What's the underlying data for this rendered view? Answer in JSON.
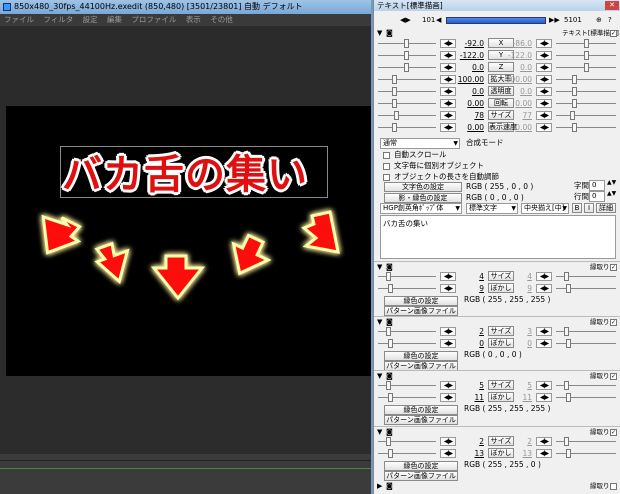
{
  "left_window": {
    "title": "850x480_30fps_44100Hz.exedit (850,480)  [3501/23801]  自動  デフォルト",
    "menu": [
      "ファイル",
      "フィルタ",
      "設定",
      "編集",
      "プロファイル",
      "表示",
      "その他"
    ],
    "caption_text": "バカ舌の集い"
  },
  "right_panel": {
    "title": "テキスト[標準描画]",
    "header": {
      "frame_start": "101",
      "frame_end": "5101",
      "object_label": "テキスト[標準描画]"
    },
    "params": [
      {
        "left": "-92.0",
        "label": "X",
        "right": "-86.0"
      },
      {
        "left": "-122.0",
        "label": "Y",
        "right": "-122.0"
      },
      {
        "left": "0.0",
        "label": "Z",
        "right": "0.0"
      },
      {
        "left": "100.00",
        "label": "拡大率",
        "right": "100.00"
      },
      {
        "left": "0.0",
        "label": "透明度",
        "right": "0.0"
      },
      {
        "left": "0.00",
        "label": "回転",
        "right": "0.00"
      },
      {
        "left": "78",
        "label": "サイズ",
        "right": "77"
      },
      {
        "left": "0.00",
        "label": "表示速度",
        "right": "0.00"
      }
    ],
    "blend_mode": "通常",
    "blend_mode_label": "合成モード",
    "checks": [
      "自動スクロール",
      "文字毎に個別オブジェクト",
      "オブジェクトの長さを自動調節"
    ],
    "text_color_btn": "文字色の設定",
    "text_color_val": "RGB ( 255 , 0 , 0 )",
    "edge_color_btn": "影・縁色の設定",
    "edge_color_val": "RGB ( 0 , 0 , 0 )",
    "spacing_label": "字間",
    "spacing_val": "0",
    "line_label": "行間",
    "line_val": "0",
    "font": "HGP創英角ﾎﾟｯﾌﾟ体",
    "style": "標準文字",
    "align": "中央揃え[中]",
    "bold": "B",
    "italic": "I",
    "detail": "詳細",
    "text_body": "バカ舌の集い",
    "filters": [
      {
        "title": "縁取り",
        "size_l": "4",
        "size_r": "4",
        "blur_l": "9",
        "blur_r": "9",
        "color_btn": "縁色の設定",
        "color_val": "RGB ( 255 , 255 , 255 )",
        "pattern": "パターン画像ファイル",
        "size_label": "サイズ",
        "blur_label": "ぼかし"
      },
      {
        "title": "縁取り",
        "size_l": "2",
        "size_r": "3",
        "blur_l": "0",
        "blur_r": "0",
        "color_btn": "縁色の設定",
        "color_val": "RGB ( 0 , 0 , 0 )",
        "pattern": "パターン画像ファイル",
        "size_label": "サイズ",
        "blur_label": "ぼかし"
      },
      {
        "title": "縁取り",
        "size_l": "5",
        "size_r": "5",
        "blur_l": "11",
        "blur_r": "11",
        "color_btn": "縁色の設定",
        "color_val": "RGB ( 255 , 255 , 255 )",
        "pattern": "パターン画像ファイル",
        "size_label": "サイズ",
        "blur_label": "ぼかし"
      },
      {
        "title": "縁取り",
        "size_l": "2",
        "size_r": "2",
        "blur_l": "13",
        "blur_r": "13",
        "color_btn": "縁色の設定",
        "color_val": "RGB ( 255 , 255 , 0 )",
        "pattern": "パターン画像ファイル",
        "size_label": "サイズ",
        "blur_label": "ぼかし"
      }
    ],
    "footer_label": "縁取り"
  }
}
